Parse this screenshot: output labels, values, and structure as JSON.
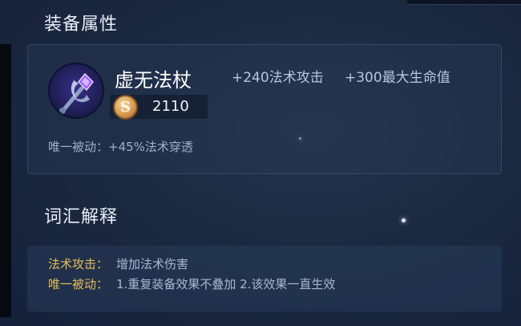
{
  "section_titles": {
    "attributes": "装备属性",
    "glossary": "词汇解释"
  },
  "item": {
    "name": "虚无法杖",
    "icon": "void-staff-icon",
    "price": "2110",
    "currency_icon": "gold-coin-icon",
    "currency_glyph": "S",
    "stats": [
      "+240法术攻击",
      "+300最大生命值"
    ],
    "passive": "唯一被动：+45%法术穿透"
  },
  "glossary": [
    {
      "term": "法术攻击：",
      "definition": "增加法术伤害"
    },
    {
      "term": "唯一被动：",
      "definition": "1.重复装备效果不叠加 2.该效果一直生效"
    }
  ],
  "colors": {
    "background": "#1b2940",
    "term_gold": "#e3bc57",
    "stat_text": "#b8c6dd"
  }
}
